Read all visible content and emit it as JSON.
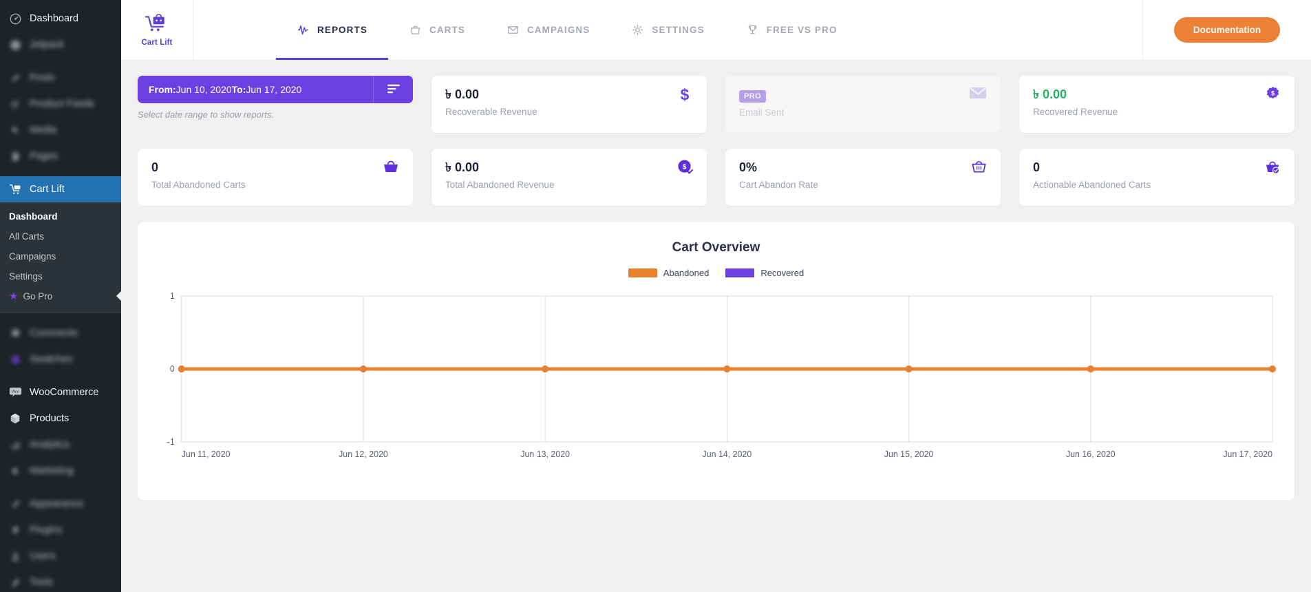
{
  "sidebar": {
    "items": [
      {
        "label": "Dashboard",
        "icon": "gauge-icon",
        "blurred": false
      },
      {
        "label": "Jetpack",
        "icon": "jetpack-icon",
        "blurred": true
      },
      {
        "label": "Posts",
        "icon": "pin-icon",
        "blurred": true
      },
      {
        "label": "Product Feeds",
        "icon": "feed-icon",
        "blurred": true
      },
      {
        "label": "Media",
        "icon": "media-icon",
        "blurred": true
      },
      {
        "label": "Pages",
        "icon": "page-icon",
        "blurred": true
      }
    ],
    "active_item": {
      "label": "Cart Lift",
      "icon": "cart-lift-icon"
    },
    "submenu": [
      {
        "label": "Dashboard",
        "current": true
      },
      {
        "label": "All Carts",
        "current": false
      },
      {
        "label": "Campaigns",
        "current": false
      },
      {
        "label": "Settings",
        "current": false
      },
      {
        "label": "Go Pro",
        "current": false,
        "icon": "star-icon"
      }
    ],
    "items_after": [
      {
        "label": "Comments",
        "icon": "comment-icon",
        "blurred": true
      },
      {
        "label": "Swatches",
        "icon": "swatches-icon",
        "blurred": true
      },
      {
        "label": "WooCommerce",
        "icon": "woo-icon",
        "blurred": false
      },
      {
        "label": "Products",
        "icon": "box-icon",
        "blurred": false
      },
      {
        "label": "Analytics",
        "icon": "analytics-icon",
        "blurred": true
      },
      {
        "label": "Marketing",
        "icon": "megaphone-icon",
        "blurred": true
      },
      {
        "label": "Appearance",
        "icon": "brush-icon",
        "blurred": true
      },
      {
        "label": "Plugins",
        "icon": "plug-icon",
        "blurred": true
      },
      {
        "label": "Users",
        "icon": "users-icon",
        "blurred": true
      },
      {
        "label": "Tools",
        "icon": "tools-icon",
        "blurred": true
      }
    ]
  },
  "topbar": {
    "brand_name": "Cart Lift",
    "tabs": [
      {
        "label": "REPORTS",
        "icon": "pulse-icon",
        "active": true
      },
      {
        "label": "CARTS",
        "icon": "basket-icon",
        "active": false
      },
      {
        "label": "CAMPAIGNS",
        "icon": "envelope-icon",
        "active": false
      },
      {
        "label": "SETTINGS",
        "icon": "gear-icon",
        "active": false
      },
      {
        "label": "FREE VS PRO",
        "icon": "trophy-icon",
        "active": false
      }
    ],
    "documentation_label": "Documentation"
  },
  "daterange": {
    "from_label": "From:",
    "from_value": " Jun 10, 2020",
    "to_label": "To:",
    "to_value": " Jun 17, 2020",
    "note": "Select date range to show reports.",
    "filter_icon": "filter-icon"
  },
  "cards": [
    {
      "value": "৳ 0.00",
      "label": "Recoverable Revenue",
      "icon": "dollar-sign-icon",
      "dim": false,
      "badge": null,
      "green": false
    },
    {
      "value": "",
      "label": "Email Sent",
      "icon": "envelope-icon",
      "dim": true,
      "badge": "PRO",
      "green": false
    },
    {
      "value": "৳ 0.00",
      "label": "Recovered Revenue",
      "icon": "dollar-seal-icon",
      "dim": false,
      "badge": null,
      "green": true
    },
    {
      "value": "0",
      "label": "Total Abandoned Carts",
      "icon": "basket-filled-icon",
      "dim": false,
      "badge": null,
      "green": false
    },
    {
      "value": "৳ 0.00",
      "label": "Total Abandoned Revenue",
      "icon": "dollar-circle-check-icon",
      "dim": false,
      "badge": null,
      "green": false
    },
    {
      "value": "0%",
      "label": "Cart Abandon Rate",
      "icon": "basket-outline-icon",
      "dim": false,
      "badge": null,
      "green": false
    },
    {
      "value": "0",
      "label": "Actionable Abandoned Carts",
      "icon": "basket-check-icon",
      "dim": false,
      "badge": null,
      "green": false
    }
  ],
  "chart_data": {
    "type": "line",
    "title": "Cart Overview",
    "xlabel": "",
    "ylabel": "",
    "grid": true,
    "legend_position": "top",
    "x": [
      "Jun 11, 2020",
      "Jun 12, 2020",
      "Jun 13, 2020",
      "Jun 14, 2020",
      "Jun 15, 2020",
      "Jun 16, 2020",
      "Jun 17, 2020"
    ],
    "ylim": [
      -1,
      1
    ],
    "yticks": [
      "1",
      "0",
      "-1"
    ],
    "series": [
      {
        "name": "Abandoned",
        "color": "#e8822e",
        "values": [
          0,
          0,
          0,
          0,
          0,
          0,
          0
        ]
      },
      {
        "name": "Recovered",
        "color": "#6c3fe0",
        "values": [
          0,
          0,
          0,
          0,
          0,
          0,
          0
        ]
      }
    ]
  },
  "colors": {
    "brand_purple": "#6c3fe0",
    "accent_orange": "#ec8135",
    "green": "#27b15e",
    "wp_dark": "#1d2327",
    "wp_blue": "#2271b1"
  }
}
